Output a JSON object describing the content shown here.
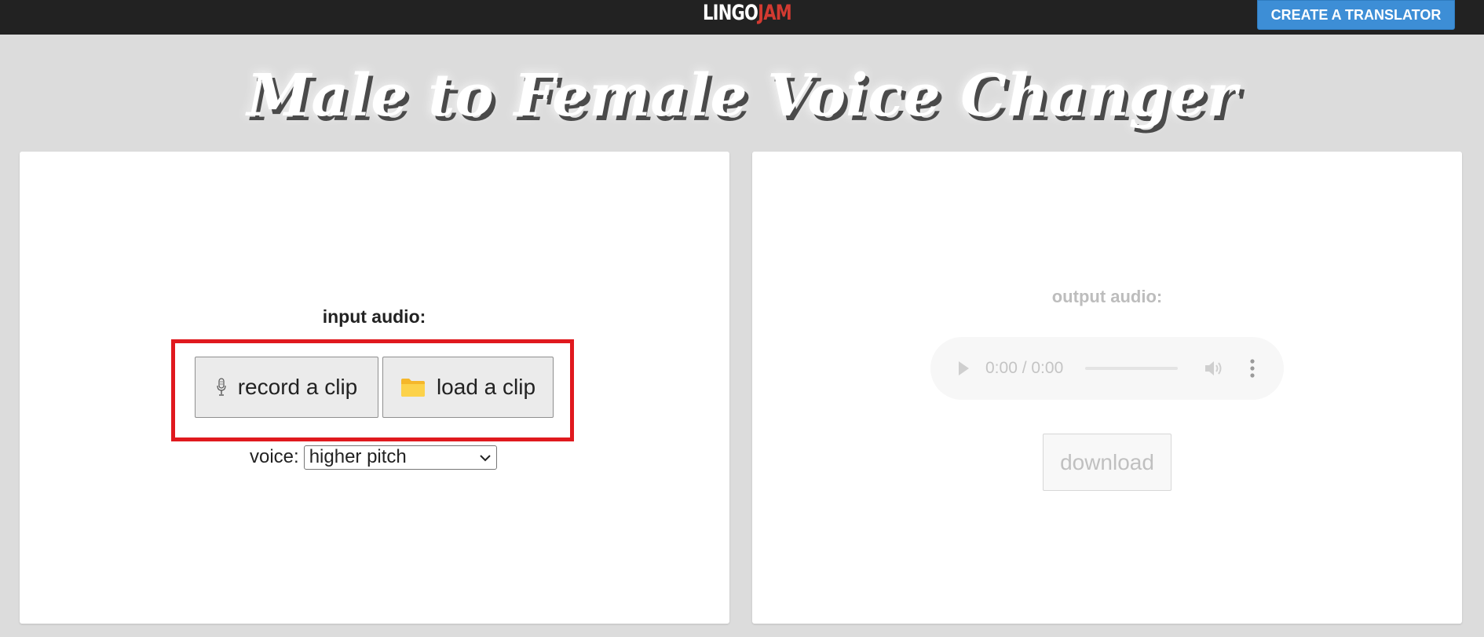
{
  "header": {
    "logo_part1": "LINGO",
    "logo_part2": "JAM",
    "create_button_label": "CREATE A TRANSLATOR"
  },
  "page": {
    "title": "Male to Female Voice Changer"
  },
  "input_panel": {
    "label": "input audio:",
    "record_button_label": "record a clip",
    "load_button_label": "load a clip",
    "voice_label": "voice:",
    "voice_selected": "higher pitch"
  },
  "output_panel": {
    "label": "output audio:",
    "player_time": "0:00 / 0:00",
    "download_button_label": "download"
  },
  "colors": {
    "topbar": "#222222",
    "accent_blue": "#3d8ed6",
    "logo_red": "#d23a31",
    "highlight_red": "#e0191e",
    "page_background": "#dcdcdc"
  },
  "icons": {
    "record": "microphone-icon",
    "load": "folder-icon",
    "select": "chevron-down-icon",
    "play": "play-icon",
    "volume": "volume-icon",
    "menu": "more-vertical-icon"
  }
}
